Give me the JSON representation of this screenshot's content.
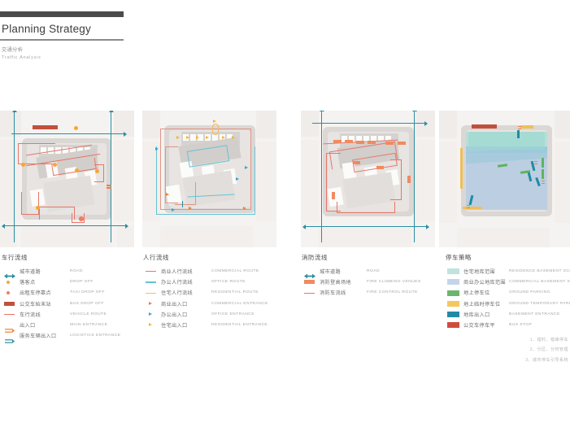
{
  "header": {
    "title": "Planning Strategy",
    "subtitle_cn": "交通分析",
    "subtitle_en": "Traffic  Analysis"
  },
  "legends": [
    {
      "title": "车行流线",
      "rows": [
        {
          "icon": "double-arrow",
          "color": "#2a8fa3",
          "cn": "城市道路",
          "en": "ROAD"
        },
        {
          "icon": "dot",
          "color": "#f5a830",
          "cn": "落客点",
          "en": "DROP OFF"
        },
        {
          "icon": "dot",
          "color": "#ef7d63",
          "cn": "出租车停靠点",
          "en": "TAXI DROP OFF"
        },
        {
          "icon": "rect",
          "color": "#c2503c",
          "cn": "公交车始末站",
          "en": "BUS DROP OFF"
        },
        {
          "icon": "line",
          "color": "#e8766a",
          "cn": "车行流线",
          "en": "VEHICLE ROUTE"
        },
        {
          "icon": "entrance",
          "color": "#f08030",
          "cn": "出入口",
          "en": "MAIN ENTRANCE"
        },
        {
          "icon": "entrance",
          "color": "#2a8fa3",
          "cn": "服务车辆出入口",
          "en": "LOGISTICS ENTRANCE"
        }
      ]
    },
    {
      "title": "人行流线",
      "rows": [
        {
          "icon": "line",
          "color": "#e8766a",
          "cn": "商业人行流线",
          "en": "COMMERCIAL ROUTE"
        },
        {
          "icon": "line",
          "color": "#63c3d6",
          "cn": "办公人行流线",
          "en": "OFFICE ROUTE"
        },
        {
          "icon": "line",
          "color": "#f0c070",
          "cn": "住宅人行流线",
          "en": "RESIDENTIAL ROUTE"
        },
        {
          "icon": "triangle",
          "color": "#f08030",
          "cn": "商业出入口",
          "en": "COMMERCIAL ENTRANCE"
        },
        {
          "icon": "triangle",
          "color": "#3b9fd6",
          "cn": "办公出入口",
          "en": "OFFICE ENTRANCE"
        },
        {
          "icon": "triangle",
          "color": "#f0b63c",
          "cn": "住宅出入口",
          "en": "RESIDENTIAL ENTRANCE"
        }
      ]
    },
    {
      "title": "消防流线",
      "rows": [
        {
          "icon": "double-arrow",
          "color": "#2a8fa3",
          "cn": "城市道路",
          "en": "ROAD"
        },
        {
          "icon": "rect",
          "color": "#f08a5f",
          "cn": "消防登高场地",
          "en": "FIRE CLIMBING VENUES"
        },
        {
          "icon": "line",
          "color": "#e8766a",
          "cn": "消防车流线",
          "en": "FIRE CONTROL ROUTE"
        }
      ]
    },
    {
      "title": "停车策略",
      "rows": [
        {
          "icon": "swatch",
          "color": "#bfe3de",
          "cn": "住宅地库范围",
          "en": "RESIDENCE BASEMENT SCOPE"
        },
        {
          "icon": "swatch",
          "color": "#c5d4e8",
          "cn": "商业办公地库范围",
          "en": "COMMERCIAL BASEMENT SCOPE"
        },
        {
          "icon": "swatch",
          "color": "#6cb56c",
          "cn": "地上停车位",
          "en": "GROUND PARKING"
        },
        {
          "icon": "swatch",
          "color": "#f5c75e",
          "cn": "地上临时停车位",
          "en": "GROUND TEMPORARY PARKING"
        },
        {
          "icon": "swatch",
          "color": "#2589a6",
          "cn": "地库出入口",
          "en": "BASEMENT ENTRANCE"
        },
        {
          "icon": "swatch",
          "color": "#cf4d3e",
          "cn": "公交车停车平",
          "en": "BUS STOP"
        }
      ]
    }
  ],
  "notes": [
    "1、错时、错峰停车",
    "2、分区、分时管理",
    "3、城市停车引导系统"
  ]
}
